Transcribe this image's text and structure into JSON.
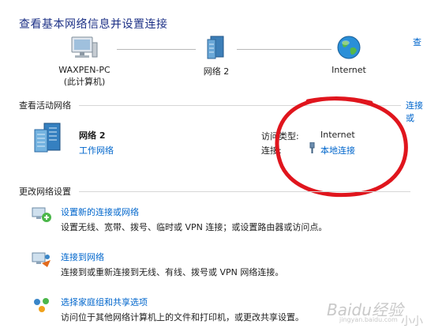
{
  "header": {
    "title": "查看基本网络信息并设置连接",
    "right_link": "查"
  },
  "network_map": {
    "computer": {
      "name": "WAXPEN-PC",
      "sub": "(此计算机)"
    },
    "network": {
      "name": "网络  2"
    },
    "internet": {
      "name": "Internet"
    }
  },
  "active_networks": {
    "section_title": "查看活动网络",
    "right_link": "连接或",
    "network_name": "网络  2",
    "network_type": "工作网络",
    "access_type_label": "访问类型:",
    "access_type_value": "Internet",
    "connection_label": "连接:",
    "connection_value": "本地连接"
  },
  "change_settings": {
    "section_title": "更改网络设置",
    "tasks": [
      {
        "link": "设置新的连接或网络",
        "desc": "设置无线、宽带、拨号、临时或 VPN 连接；或设置路由器或访问点。"
      },
      {
        "link": "连接到网络",
        "desc": "连接到或重新连接到无线、有线、拨号或 VPN 网络连接。"
      },
      {
        "link": "选择家庭组和共享选项",
        "desc": "访问位于其他网络计算机上的文件和打印机，或更改共享设置。"
      }
    ]
  },
  "watermark": {
    "text": "Baidu经验",
    "sub": "jingyan.baidu.com",
    "corner": "小小"
  },
  "colors": {
    "annotation": "#e0151d",
    "link": "#0066cc",
    "title": "#1e3287"
  }
}
